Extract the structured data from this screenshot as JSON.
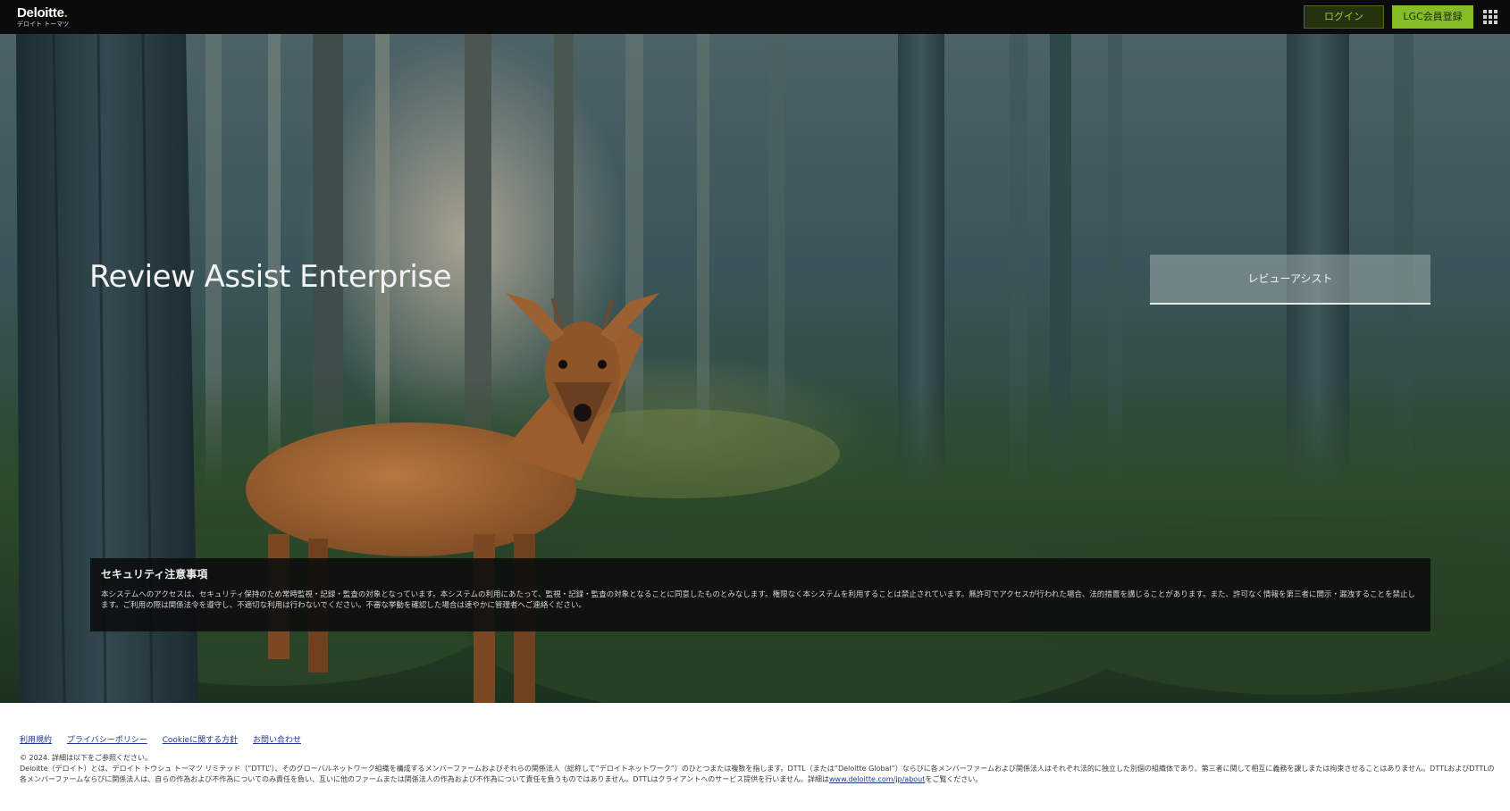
{
  "header": {
    "logo_main": "Deloitte",
    "logo_dot": ".",
    "logo_sub": "デロイト トーマツ",
    "login_label": "ログイン",
    "signup_label": "LGC会員登録",
    "apps_icon": "grid-icon"
  },
  "hero": {
    "title": "Review Assist Enterprise",
    "review_button_label": "レビューアシスト",
    "notice_title": "セキュリティ注意事項",
    "notice_body": "本システムへのアクセスは、セキュリティ保持のため常時監視・記録・監査の対象となっています。本システムの利用にあたって、監視・記録・監査の対象となることに同意したものとみなします。権限なく本システムを利用することは禁止されています。無許可でアクセスが行われた場合、法的措置を講じることがあります。また、許可なく情報を第三者に開示・漏洩することを禁止します。ご利用の際は関係法令を遵守し、不適切な利用は行わないでください。不審な挙動を確認した場合は速やかに管理者へご連絡ください。"
  },
  "footer": {
    "links": [
      "利用規約",
      "プライバシーポリシー",
      "Cookieに関する方針",
      "お問い合わせ"
    ],
    "copyright": "© 2024. 詳細は以下をご参照ください。",
    "body": "Deloitte（デロイト）とは、デロイト トウシュ トーマツ リミテッド（“DTTL”）、そのグローバルネットワーク組織を構成するメンバーファームおよびそれらの関係法人（総称して“デロイトネットワーク”）のひとつまたは複数を指します。DTTL（または“Deloitte Global”）ならびに各メンバーファームおよび関係法人はそれぞれ法的に独立した別個の組織体であり、第三者に関して相互に義務を課しまたは拘束させることはありません。DTTLおよびDTTLの各メンバーファームならびに関係法人は、自らの作為および不作為についてのみ責任を負い、互いに他のファームまたは関係法人の作為および不作為について責任を負うものではありません。DTTLはクライアントへのサービス提供を行いません。詳細は",
    "body_link": "www.deloitte.com/jp/about",
    "body_end": "をご覧ください。"
  }
}
